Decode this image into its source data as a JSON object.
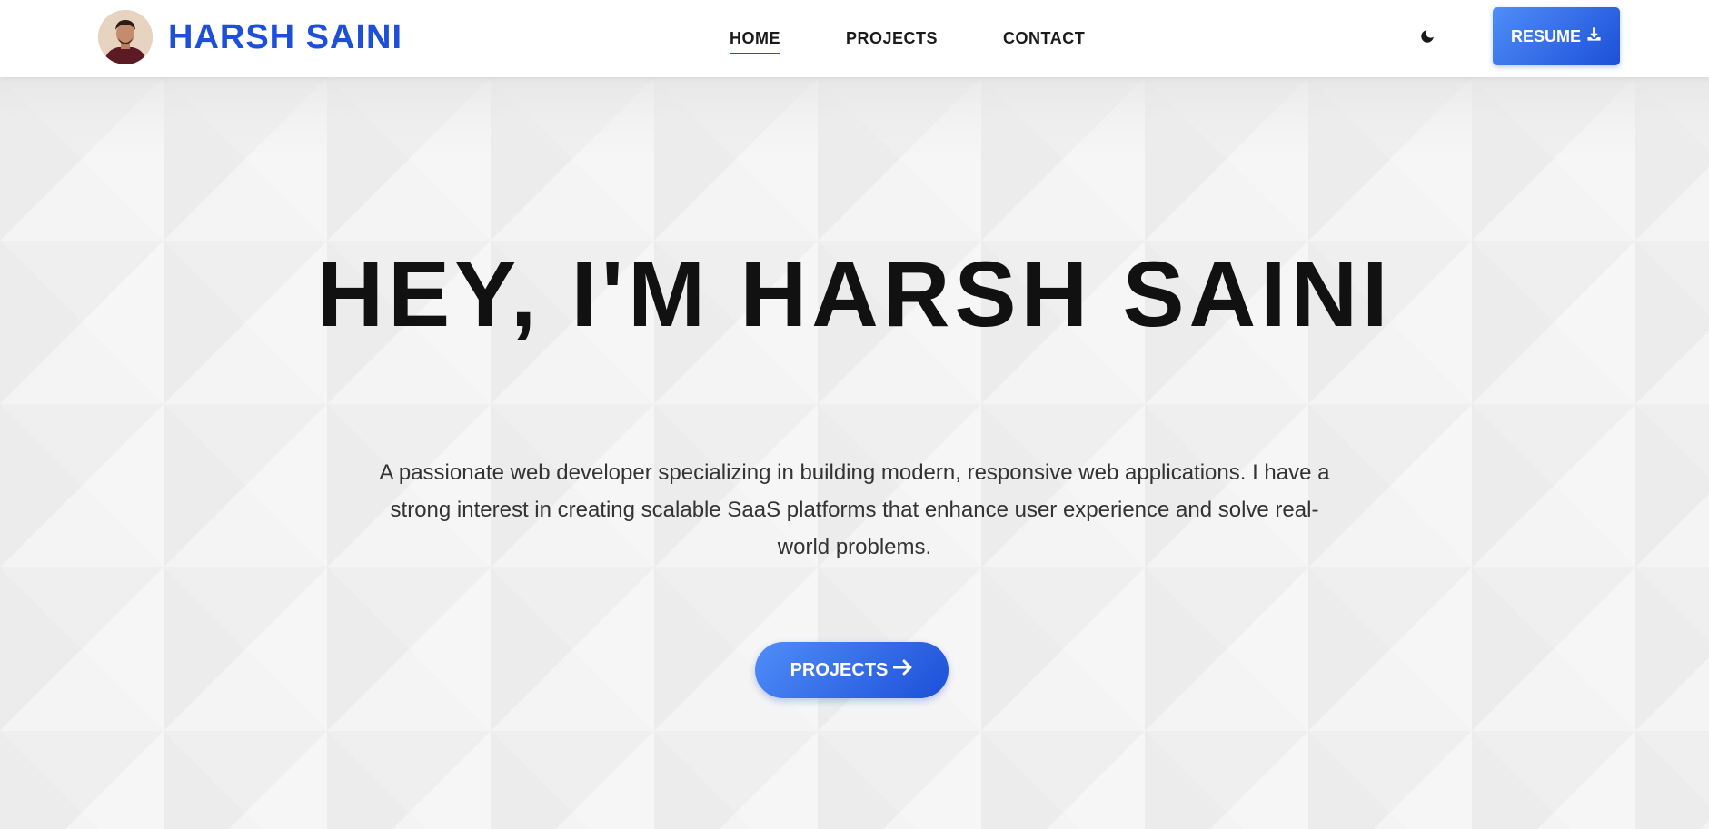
{
  "nav": {
    "brand_name": "HARSH SAINI",
    "links": [
      {
        "label": "HOME",
        "active": true
      },
      {
        "label": "PROJECTS",
        "active": false
      },
      {
        "label": "CONTACT",
        "active": false
      }
    ],
    "theme_toggle_icon": "moon-icon",
    "resume_button": {
      "label": "RESUME",
      "icon": "download-icon"
    }
  },
  "hero": {
    "title": "HEY, I'M HARSH SAINI",
    "description": "A passionate web developer specializing in building modern, responsive web applications. I have a strong interest in creating scalable SaaS platforms that enhance user experience and solve real-world problems.",
    "cta_button": {
      "label": "PROJECTS",
      "icon": "arrow-right-icon"
    }
  },
  "colors": {
    "accent": "#1d4fd8",
    "accent_light": "#4f8ef7",
    "nav_background": "#ffffff",
    "hero_background": "#f2f2f2",
    "title_text": "#111111",
    "body_text": "#333333"
  }
}
